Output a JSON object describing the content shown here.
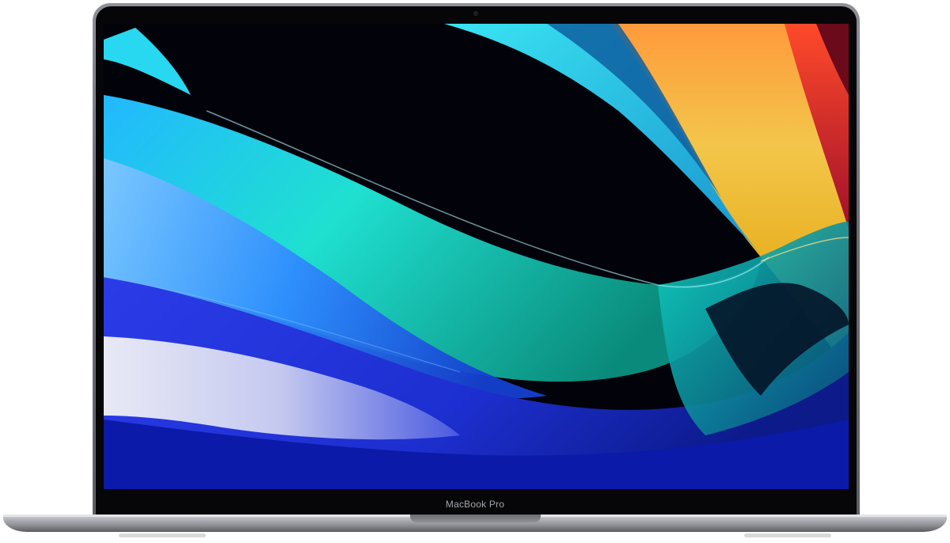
{
  "device": {
    "model_label": "MacBook Pro",
    "finish_color": "#6d6f74"
  },
  "screen": {
    "wallpaper": "abstract-color-wave",
    "colors": [
      "#1fd1e6",
      "#2a3de0",
      "#0b1fa8",
      "#f3a21f",
      "#e0421f",
      "#8ad0ff"
    ]
  }
}
